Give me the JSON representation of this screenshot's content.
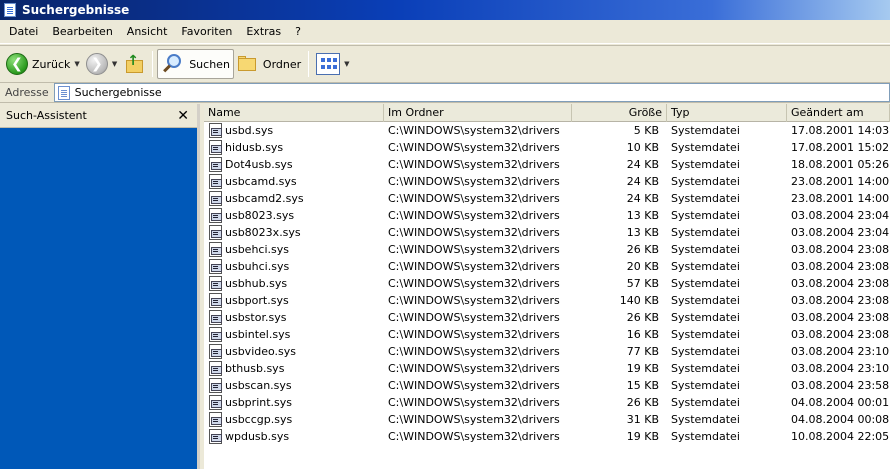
{
  "window": {
    "title": "Suchergebnisse"
  },
  "menu": [
    "Datei",
    "Bearbeiten",
    "Ansicht",
    "Favoriten",
    "Extras",
    "?"
  ],
  "toolbar": {
    "back": "Zurück",
    "search": "Suchen",
    "folders": "Ordner"
  },
  "address": {
    "label": "Adresse",
    "value": "Suchergebnisse"
  },
  "sidepane": {
    "title": "Such-Assistent",
    "close": "✕"
  },
  "columns": [
    "Name",
    "Im Ordner",
    "Größe",
    "Typ",
    "Geändert am"
  ],
  "files": [
    [
      "usbd.sys",
      "C:\\WINDOWS\\system32\\drivers",
      "5 KB",
      "Systemdatei",
      "17.08.2001 14:03"
    ],
    [
      "hidusb.sys",
      "C:\\WINDOWS\\system32\\drivers",
      "10 KB",
      "Systemdatei",
      "17.08.2001 15:02"
    ],
    [
      "Dot4usb.sys",
      "C:\\WINDOWS\\system32\\drivers",
      "24 KB",
      "Systemdatei",
      "18.08.2001 05:26"
    ],
    [
      "usbcamd.sys",
      "C:\\WINDOWS\\system32\\drivers",
      "24 KB",
      "Systemdatei",
      "23.08.2001 14:00"
    ],
    [
      "usbcamd2.sys",
      "C:\\WINDOWS\\system32\\drivers",
      "24 KB",
      "Systemdatei",
      "23.08.2001 14:00"
    ],
    [
      "usb8023.sys",
      "C:\\WINDOWS\\system32\\drivers",
      "13 KB",
      "Systemdatei",
      "03.08.2004 23:04"
    ],
    [
      "usb8023x.sys",
      "C:\\WINDOWS\\system32\\drivers",
      "13 KB",
      "Systemdatei",
      "03.08.2004 23:04"
    ],
    [
      "usbehci.sys",
      "C:\\WINDOWS\\system32\\drivers",
      "26 KB",
      "Systemdatei",
      "03.08.2004 23:08"
    ],
    [
      "usbuhci.sys",
      "C:\\WINDOWS\\system32\\drivers",
      "20 KB",
      "Systemdatei",
      "03.08.2004 23:08"
    ],
    [
      "usbhub.sys",
      "C:\\WINDOWS\\system32\\drivers",
      "57 KB",
      "Systemdatei",
      "03.08.2004 23:08"
    ],
    [
      "usbport.sys",
      "C:\\WINDOWS\\system32\\drivers",
      "140 KB",
      "Systemdatei",
      "03.08.2004 23:08"
    ],
    [
      "usbstor.sys",
      "C:\\WINDOWS\\system32\\drivers",
      "26 KB",
      "Systemdatei",
      "03.08.2004 23:08"
    ],
    [
      "usbintel.sys",
      "C:\\WINDOWS\\system32\\drivers",
      "16 KB",
      "Systemdatei",
      "03.08.2004 23:08"
    ],
    [
      "usbvideo.sys",
      "C:\\WINDOWS\\system32\\drivers",
      "77 KB",
      "Systemdatei",
      "03.08.2004 23:10"
    ],
    [
      "bthusb.sys",
      "C:\\WINDOWS\\system32\\drivers",
      "19 KB",
      "Systemdatei",
      "03.08.2004 23:10"
    ],
    [
      "usbscan.sys",
      "C:\\WINDOWS\\system32\\drivers",
      "15 KB",
      "Systemdatei",
      "03.08.2004 23:58"
    ],
    [
      "usbprint.sys",
      "C:\\WINDOWS\\system32\\drivers",
      "26 KB",
      "Systemdatei",
      "04.08.2004 00:01"
    ],
    [
      "usbccgp.sys",
      "C:\\WINDOWS\\system32\\drivers",
      "31 KB",
      "Systemdatei",
      "04.08.2004 00:08"
    ],
    [
      "wpdusb.sys",
      "C:\\WINDOWS\\system32\\drivers",
      "19 KB",
      "Systemdatei",
      "10.08.2004 22:05"
    ]
  ]
}
